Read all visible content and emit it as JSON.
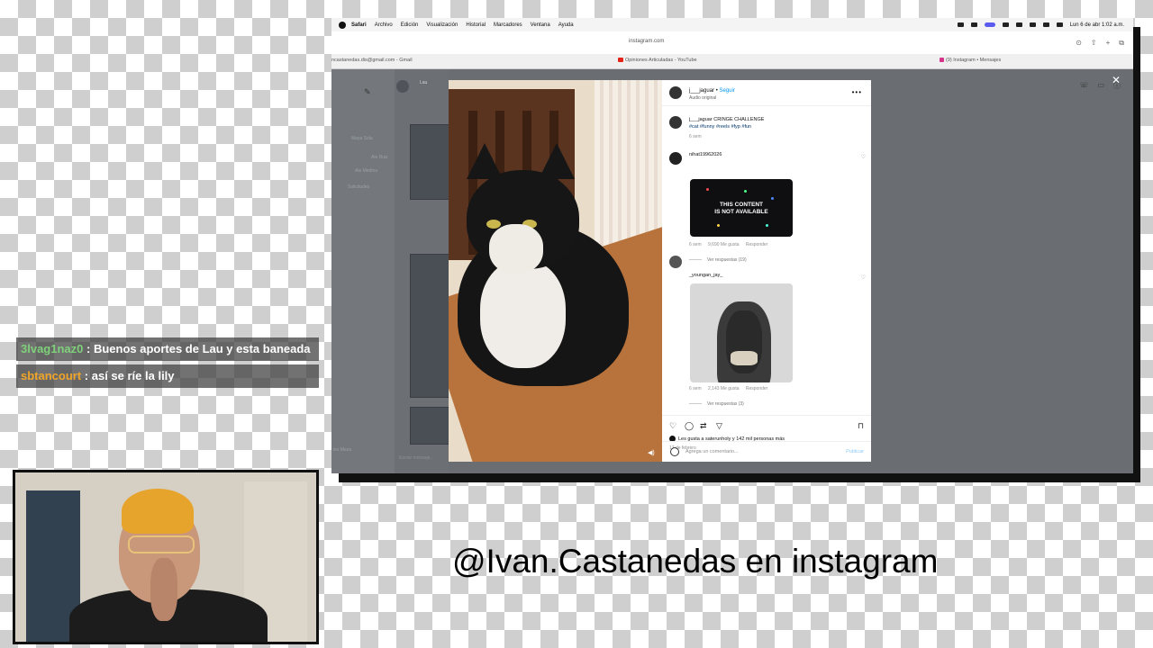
{
  "menubar": {
    "app": "Safari",
    "items": [
      "Archivo",
      "Edición",
      "Visualización",
      "Historial",
      "Marcadores",
      "Ventana",
      "Ayuda"
    ],
    "clock": "Lun 6 de abr  1:02 a.m."
  },
  "browser": {
    "url": "instagram.com",
    "tabs": [
      {
        "label": "ncastanedas.dis@gmail.com - Gmail"
      },
      {
        "label": "Opiniones Articuladas - YouTube"
      },
      {
        "label": "(9) Instagram • Mensajes"
      }
    ]
  },
  "dm": {
    "contact": "Lau",
    "requests": "Solicitudes",
    "sidebar_names": [
      "Maya Sola",
      "Ale Ruiz",
      "Ale Medina"
    ],
    "left_bottom": "les Meza",
    "message_placeholder": "Enviar mensaje..."
  },
  "post": {
    "username": "j___jaguar",
    "follow": "Seguir",
    "audio": "Audio original",
    "caption_user": "j___jaguar",
    "caption_text": "CRINGE CHALLENGE",
    "hashtags": "#cat #funny #reels #fyp #fun",
    "caption_time": "6 sem",
    "comments": [
      {
        "user": "nihat19962026",
        "gif_line1": "THIS CONTENT",
        "gif_line2": "IS NOT AVAILABLE",
        "time": "6 sem",
        "likes": "9,690 Me gusta",
        "reply": "Responder",
        "replies": "Ver respuestas (19)"
      },
      {
        "user": "_youngan_jay_",
        "time": "6 sem",
        "likes": "2,143 Me gusta",
        "reply": "Responder",
        "replies": "Ver respuestas (3)"
      }
    ],
    "likes_text": "Les gusta a saterunholy y 142 mil personas más",
    "date": "17 de febrero",
    "comment_placeholder": "Agrega un comentario...",
    "publish": "Publicar"
  },
  "chat": [
    {
      "user": "3lvag1naz0",
      "text": ": Buenos aportes de Lau y esta baneada"
    },
    {
      "user": "sbtancourt",
      "text": ": así se ríe la lily"
    }
  ],
  "handle": "@Ivan.Castanedas en instagram",
  "colors": {
    "link_blue": "#0095f6",
    "chat_user1": "#7fd07a",
    "chat_user2": "#f0a52a",
    "youtube_red": "#e62117",
    "instagram_pink": "#d6338a"
  },
  "icons": [
    "apple-icon",
    "heart-icon",
    "comment-icon",
    "share-icon",
    "bookmark-icon",
    "emoji-icon",
    "close-icon",
    "more-icon",
    "phone-icon",
    "video-icon",
    "info-icon",
    "speaker-icon",
    "share-page-icon",
    "new-tab-icon"
  ]
}
